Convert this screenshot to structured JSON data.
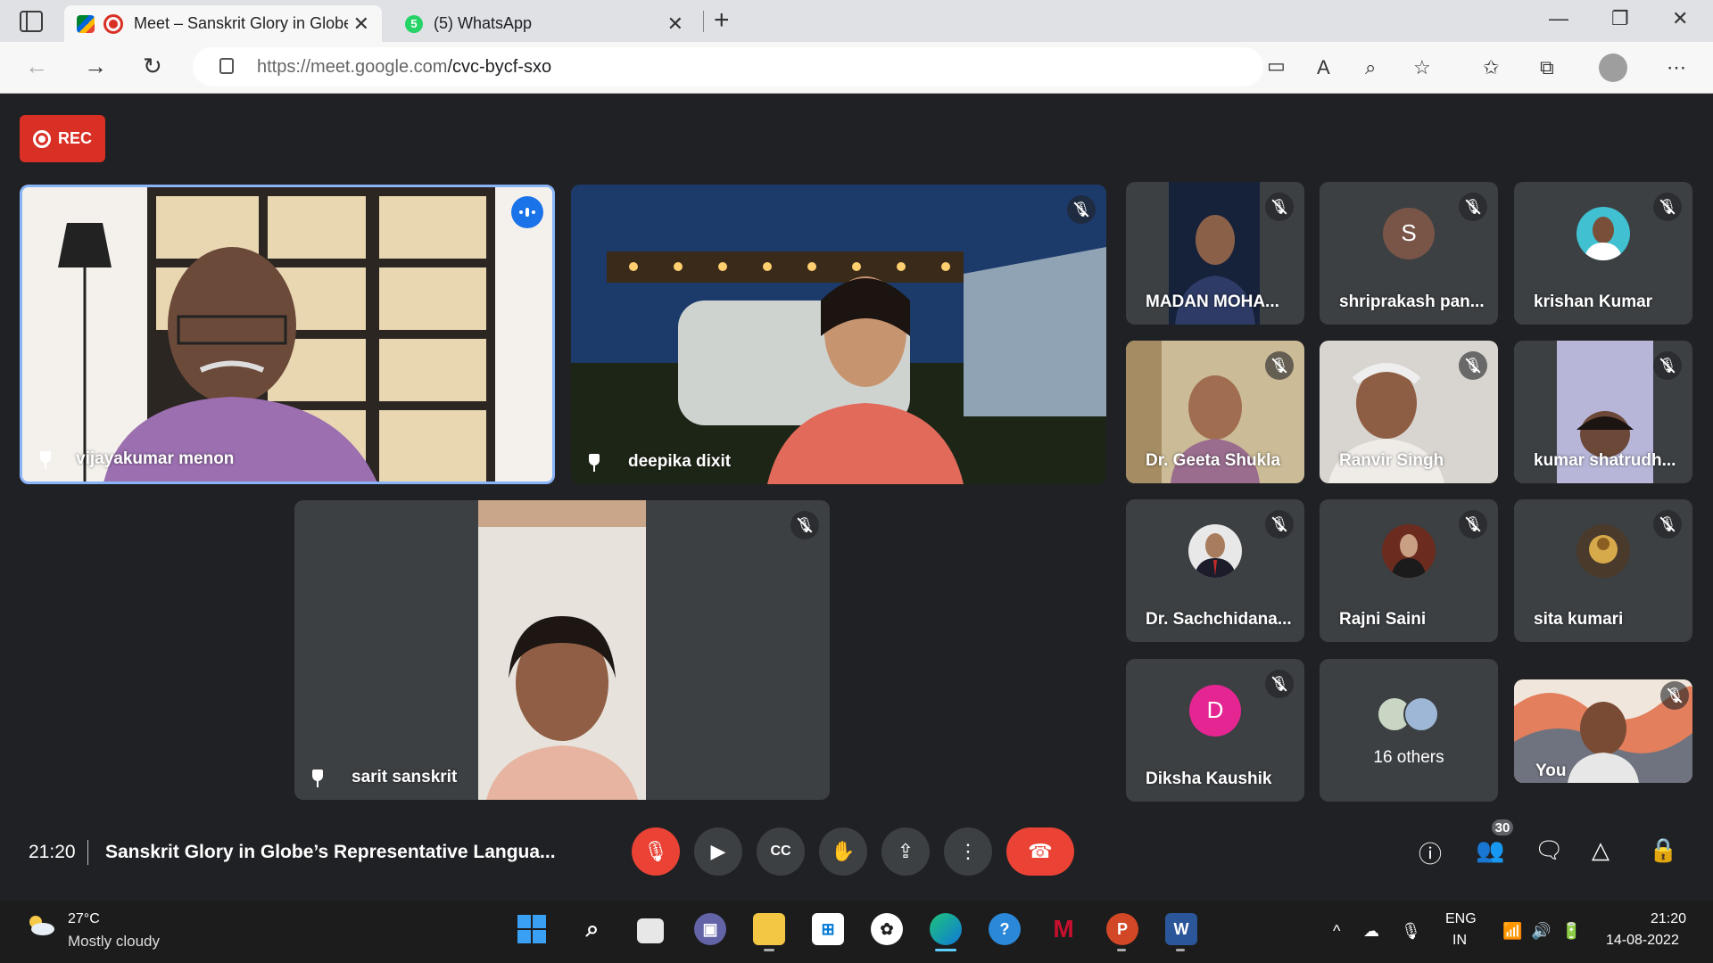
{
  "browser": {
    "tabs": [
      {
        "title": "Meet – Sanskrit Glory in Globe's Representative Language",
        "close": "✕"
      },
      {
        "title": "(5) WhatsApp",
        "close": "✕"
      }
    ],
    "new_tab": "+",
    "url_host": "https://meet.google.com",
    "url_path": "/cvc-bycf-sxo"
  },
  "meet": {
    "rec_label": "REC",
    "main_tiles": [
      {
        "name": "vijayakumar menon"
      },
      {
        "name": "deepika dixit"
      },
      {
        "name": "sarit sanskrit"
      }
    ],
    "grid": [
      {
        "name": "MADAN MOHA..."
      },
      {
        "name": "shriprakash pan...",
        "initial": "S"
      },
      {
        "name": "krishan Kumar"
      },
      {
        "name": "Dr. Geeta Shukla"
      },
      {
        "name": "Ranvir Singh"
      },
      {
        "name": "kumar shatrudh..."
      },
      {
        "name": "Dr. Sachchidana..."
      },
      {
        "name": "Rajni Saini"
      },
      {
        "name": "sita kumari"
      },
      {
        "name": "Diksha Kaushik",
        "initial": "D"
      },
      {
        "name": "16 others"
      },
      {
        "name": "You"
      }
    ],
    "clock": "21:20",
    "title": "Sanskrit Glory in Globe’s Representative Langua...",
    "participants_count": "30"
  },
  "taskbar": {
    "temp": "27°C",
    "weather": "Mostly cloudy",
    "lang_line1": "ENG",
    "lang_line2": "IN",
    "time": "21:20",
    "date": "14-08-2022"
  },
  "colors": {
    "meet_bg": "#202124",
    "tile_bg": "#3c4043",
    "accent_red": "#ea4335",
    "speaking_blue": "#1a73e8"
  }
}
